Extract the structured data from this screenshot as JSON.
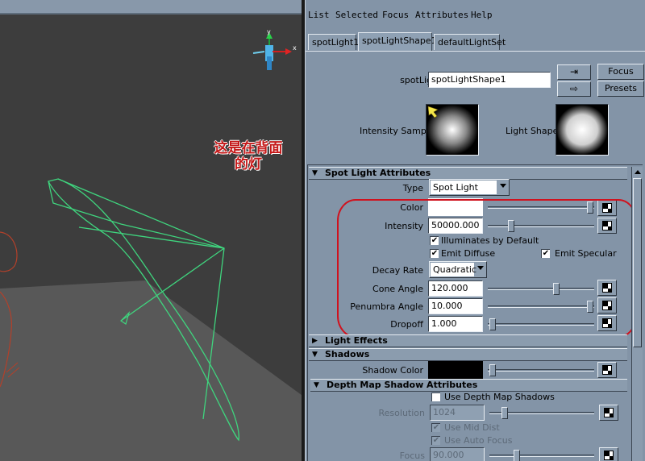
{
  "annotation": {
    "line1": "这是在背面",
    "line2": "的灯",
    "color": "#c41818"
  },
  "viewport": {
    "background": "#3d3d3d",
    "gnomon_axes": [
      "y",
      "x"
    ],
    "wire_color": "#3fd57e"
  },
  "menu": [
    "List",
    "Selected",
    "Focus",
    "Attributes",
    "Help"
  ],
  "tabs": [
    "spotLight1",
    "spotLightShape1",
    "defaultLightSet"
  ],
  "header": {
    "node_label": "spotLight:",
    "node_value": "spotLightShape1",
    "focus_label": "Focus",
    "presets_label": "Presets",
    "intensity_sample_label": "Intensity Sample",
    "light_shape_label": "Light Shape"
  },
  "sections": {
    "spot_light_attributes": "Spot Light Attributes",
    "light_effects": "Light Effects",
    "shadows": "Shadows",
    "depth_map": "Depth Map Shadow Attributes"
  },
  "spot": {
    "type_label": "Type",
    "type_value": "Spot Light",
    "color_label": "Color",
    "color_value": "#ffffff",
    "intensity_label": "Intensity",
    "intensity_value": "50000.000",
    "illum_label": "Illuminates by Default",
    "illum_checked": true,
    "diffuse_label": "Emit Diffuse",
    "diffuse_checked": true,
    "specular_label": "Emit Specular",
    "specular_checked": true,
    "decay_label": "Decay Rate",
    "decay_value": "Quadratic",
    "cone_label": "Cone Angle",
    "cone_value": "120.000",
    "penumbra_label": "Penumbra Angle",
    "penumbra_value": "10.000",
    "dropoff_label": "Dropoff",
    "dropoff_value": "1.000",
    "color_slider_level": 1.0,
    "intensity_slider_level": 0.2,
    "cone_slider_level": 0.66,
    "penumbra_slider_level": 1.0,
    "dropoff_slider_level": 0.02
  },
  "shadows": {
    "color_label": "Shadow Color",
    "color_value": "#000000",
    "slider_level": 0.02
  },
  "depth": {
    "use_label": "Use Depth Map Shadows",
    "use_checked": false,
    "resolution_label": "Resolution",
    "resolution_value": "1024",
    "resolution_slider_level": 0.12,
    "mid_label": "Use Mid Dist",
    "mid_checked": true,
    "auto_label": "Use Auto Focus",
    "auto_checked": true,
    "focus_label": "Focus",
    "focus_value": "90.000",
    "focus_slider_level": 0.25
  },
  "highlight_color": "#d0121e"
}
